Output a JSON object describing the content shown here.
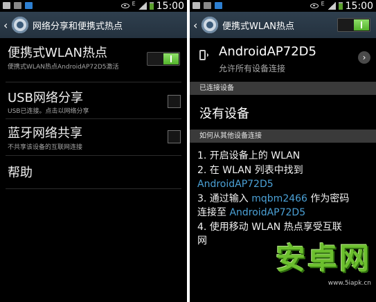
{
  "status_bar": {
    "time": "15:00",
    "extra_glyph": "E"
  },
  "left": {
    "title": "网络分享和便携式热点",
    "items": [
      {
        "title": "便携式WLAN热点",
        "subtitle": "便携式WLAN热点AndroidAP72D5激活",
        "control": "switch-on"
      },
      {
        "title": "USB网络分享",
        "subtitle": "USB已连接。点击以网络分享",
        "control": "checkbox-unchecked"
      },
      {
        "title": "蓝牙网络共享",
        "subtitle": "不共享该设备的互联网连接",
        "control": "checkbox-unchecked"
      },
      {
        "title": "帮助"
      }
    ]
  },
  "right": {
    "title": "便携式WLAN热点",
    "hotspot": {
      "name": "AndroidAP72D5",
      "subtitle": "允许所有设备连接"
    },
    "sections": {
      "connected_header": "已连接设备",
      "connected_empty": "没有设备",
      "howto_header": "如何从其他设备连接"
    },
    "instructions": {
      "l1": "1. 开启设备上的 WLAN",
      "l2": "2. 在 WLAN 列表中找到",
      "l2b": "AndroidAP72D5",
      "l3a": "3. 通过输入 ",
      "l3b": "mqbm2466",
      "l3c": " 作为密码",
      "l4a": "连接至 ",
      "l4b": "AndroidAP72D5",
      "l5": "4. 使用移动 WLAN 热点享受互联",
      "l6": "网"
    }
  },
  "watermark": {
    "main": "安卓网",
    "url": "www.5iapk.cn"
  },
  "colors": {
    "accent_link": "#4ba1d6",
    "switch_green": "#6cc13c",
    "actionbar": "#2a3846"
  }
}
